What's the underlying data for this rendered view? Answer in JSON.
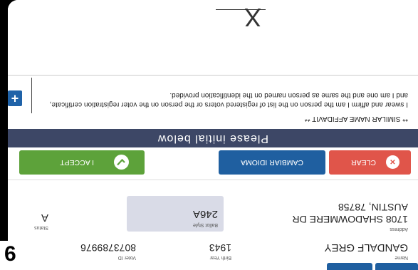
{
  "step_badge": "6",
  "voter": {
    "name_label": "Name",
    "name": "GANDALF GREY",
    "birth_year_label": "Birth Year",
    "birth_year": "1943",
    "voter_id_label": "Voter ID",
    "voter_id": "8073789976",
    "address_label": "Address",
    "address_line1": "1708 SHADOWMERE DR",
    "address_line2": "AUSTIN, 78758",
    "ballot_style_label": "Ballot Style",
    "ballot_style": "246A",
    "status_label": "Status",
    "status": "A"
  },
  "buttons": {
    "clear": "CLEAR",
    "change_language": "CAMBIAR IDIOMA",
    "accept": "I ACCEPT"
  },
  "initial_bar": "Please initial below",
  "affidavit": {
    "title": "** SIMILAR NAME AFFIDAVIT **",
    "text": "I swear and affirm I am the person on the list of registered voters or the person on the voter registration certificate, and I am one and the same as person named on the identification provided."
  },
  "plus_label": "+",
  "signature_mark": "X",
  "colors": {
    "clear": "#e0554a",
    "change_language": "#1f5fa0",
    "accept": "#5da23a",
    "bar": "#3d4766"
  }
}
